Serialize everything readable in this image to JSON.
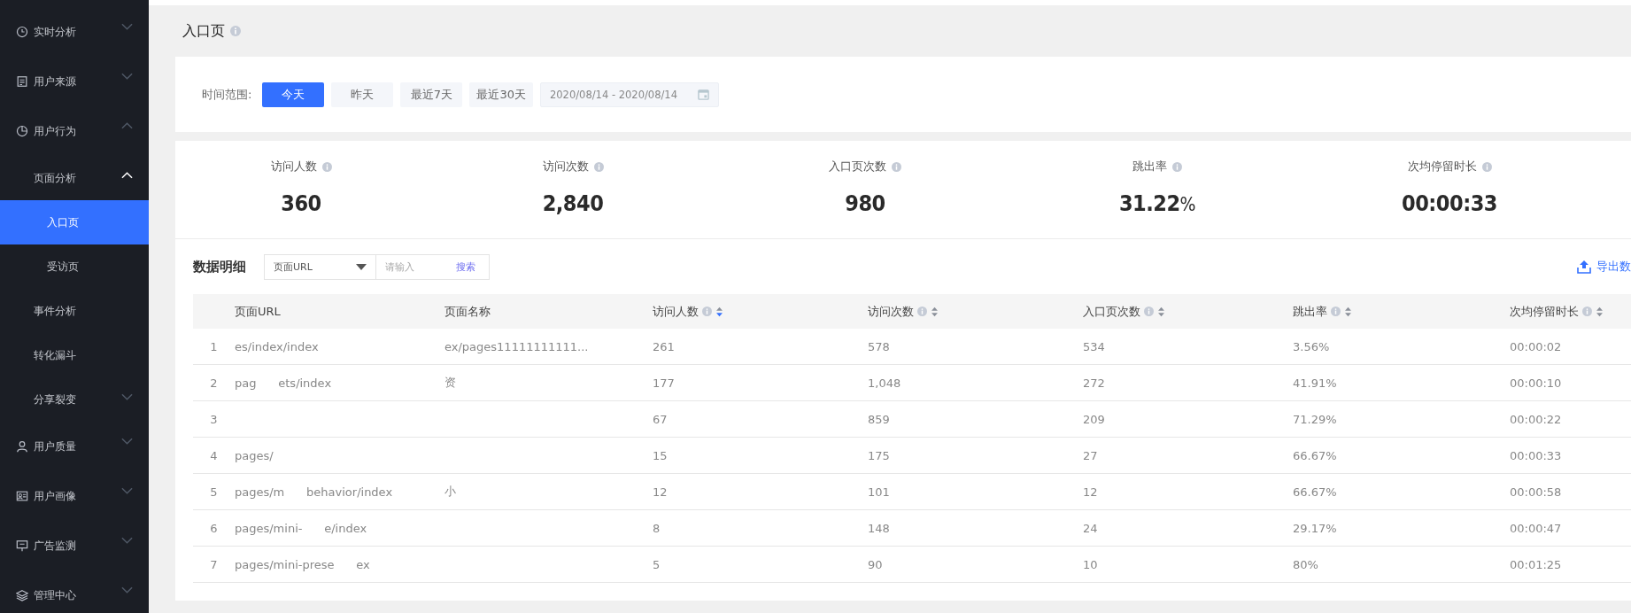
{
  "sidebar": {
    "items": [
      {
        "label": "实时分析",
        "kind": "group",
        "expanded": false,
        "selected": false
      },
      {
        "label": "用户来源",
        "kind": "group",
        "expanded": false,
        "selected": false
      },
      {
        "label": "用户行为",
        "kind": "group",
        "expanded": true,
        "selected": false,
        "children": [
          {
            "label": "页面分析",
            "kind": "section",
            "expanded": true,
            "selected": false,
            "children": [
              {
                "label": "入口页",
                "kind": "leaf",
                "selected": true
              },
              {
                "label": "受访页",
                "kind": "leaf",
                "selected": false
              }
            ]
          },
          {
            "label": "事件分析",
            "kind": "section",
            "selected": false
          },
          {
            "label": "转化漏斗",
            "kind": "section",
            "selected": false
          },
          {
            "label": "分享裂变",
            "kind": "section",
            "expanded": false,
            "selected": false
          }
        ]
      },
      {
        "label": "用户质量",
        "kind": "group",
        "expanded": false,
        "selected": false
      },
      {
        "label": "用户画像",
        "kind": "group",
        "expanded": false,
        "selected": false
      },
      {
        "label": "广告监测",
        "kind": "group",
        "expanded": false,
        "selected": false
      },
      {
        "label": "管理中心",
        "kind": "group",
        "expanded": false,
        "selected": false
      }
    ]
  },
  "page": {
    "title": "入口页"
  },
  "filter": {
    "label": "时间范围:",
    "ranges": [
      {
        "label": "今天",
        "selected": true
      },
      {
        "label": "昨天",
        "selected": false
      },
      {
        "label": "最近7天",
        "selected": false
      },
      {
        "label": "最近30天",
        "selected": false
      }
    ],
    "date_range": "2020/08/14 - 2020/08/14"
  },
  "stats": [
    {
      "label": "访问人数",
      "value": "360"
    },
    {
      "label": "访问次数",
      "value": "2,840"
    },
    {
      "label": "入口页次数",
      "value": "980"
    },
    {
      "label": "跳出率",
      "value": "31.22",
      "unit": "%"
    },
    {
      "label": "次均停留时长",
      "value": "00:00:33"
    }
  ],
  "detail": {
    "title": "数据明细",
    "dropdown": "页面URL",
    "search": {
      "placeholder": "请输入",
      "button": "搜索"
    },
    "export": "导出数",
    "columns": [
      {
        "label": "页面URL",
        "info": false,
        "sortable": false
      },
      {
        "label": "页面名称",
        "info": false,
        "sortable": false
      },
      {
        "label": "访问人数",
        "info": true,
        "sortable": true,
        "sorted_desc": true
      },
      {
        "label": "访问次数",
        "info": true,
        "sortable": true,
        "sorted_desc": false
      },
      {
        "label": "入口页次数",
        "info": true,
        "sortable": true,
        "sorted_desc": false
      },
      {
        "label": "跳出率",
        "info": true,
        "sortable": true,
        "sorted_desc": false
      },
      {
        "label": "次均停留时长",
        "info": true,
        "sortable": true,
        "sorted_desc": false
      }
    ],
    "rows": [
      {
        "index": "1",
        "cells": [
          "es/index/index",
          "ex/pages11111111111...",
          "261",
          "578",
          "534",
          "3.56%",
          "00:00:02"
        ]
      },
      {
        "index": "2",
        "cells": [
          "pag      ets/index",
          "资",
          "177",
          "1,048",
          "272",
          "41.91%",
          "00:00:10"
        ]
      },
      {
        "index": "3",
        "cells": [
          "",
          "",
          "67",
          "859",
          "209",
          "71.29%",
          "00:00:22"
        ]
      },
      {
        "index": "4",
        "cells": [
          "pages/",
          "",
          "15",
          "175",
          "27",
          "66.67%",
          "00:00:33"
        ]
      },
      {
        "index": "5",
        "cells": [
          "pages/m      behavior/index",
          "小",
          "12",
          "101",
          "12",
          "66.67%",
          "00:00:58"
        ]
      },
      {
        "index": "6",
        "cells": [
          "pages/mini-      e/index",
          "",
          "8",
          "148",
          "24",
          "29.17%",
          "00:00:47"
        ]
      },
      {
        "index": "7",
        "cells": [
          "pages/mini-prese      ex",
          "",
          "5",
          "90",
          "10",
          "80%",
          "00:01:25"
        ]
      }
    ]
  }
}
